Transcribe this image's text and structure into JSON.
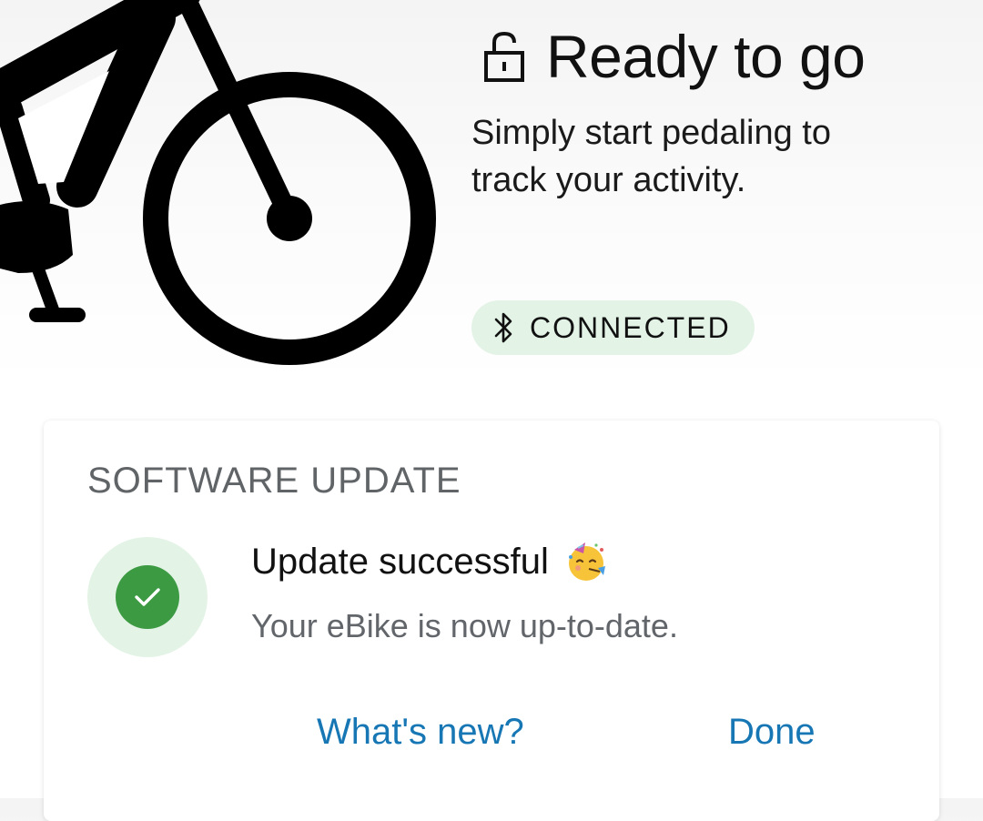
{
  "status": {
    "title": "Ready to go",
    "subtitle": "Simply start pedaling to track your activity.",
    "lock_icon": "unlocked-padlock-icon"
  },
  "connection": {
    "label": "CONNECTED",
    "icon": "bluetooth-icon",
    "badge_color": "#e3f3e6"
  },
  "software_update": {
    "heading": "SOFTWARE UPDATE",
    "title": "Update successful",
    "title_emoji": "partying-face-icon",
    "description": "Your eBike is now up-to-date.",
    "status_icon": "check-icon",
    "status_color": "#3c9a43",
    "buttons": {
      "whats_new": "What's new?",
      "done": "Done"
    },
    "button_color": "#1777b4"
  }
}
